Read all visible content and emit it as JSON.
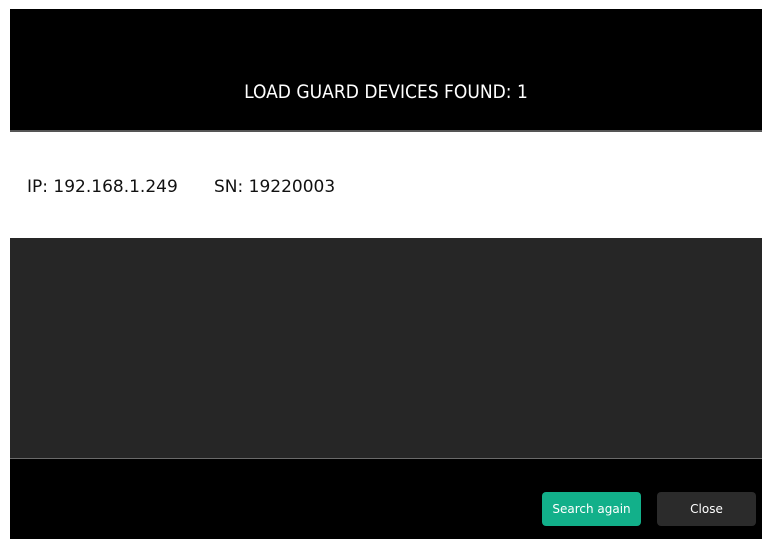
{
  "header": {
    "title": "LOAD GUARD DEVICES FOUND: 1"
  },
  "devices": [
    {
      "ip": "IP: 192.168.1.249",
      "sn": "SN: 19220003"
    }
  ],
  "footer": {
    "search_again_label": "Search again",
    "close_label": "Close"
  },
  "colors": {
    "accent": "#12b08a",
    "dialog_background": "#000000",
    "list_background": "#ffffff",
    "empty_area": "#262626",
    "secondary_button": "#2b2b2b"
  }
}
